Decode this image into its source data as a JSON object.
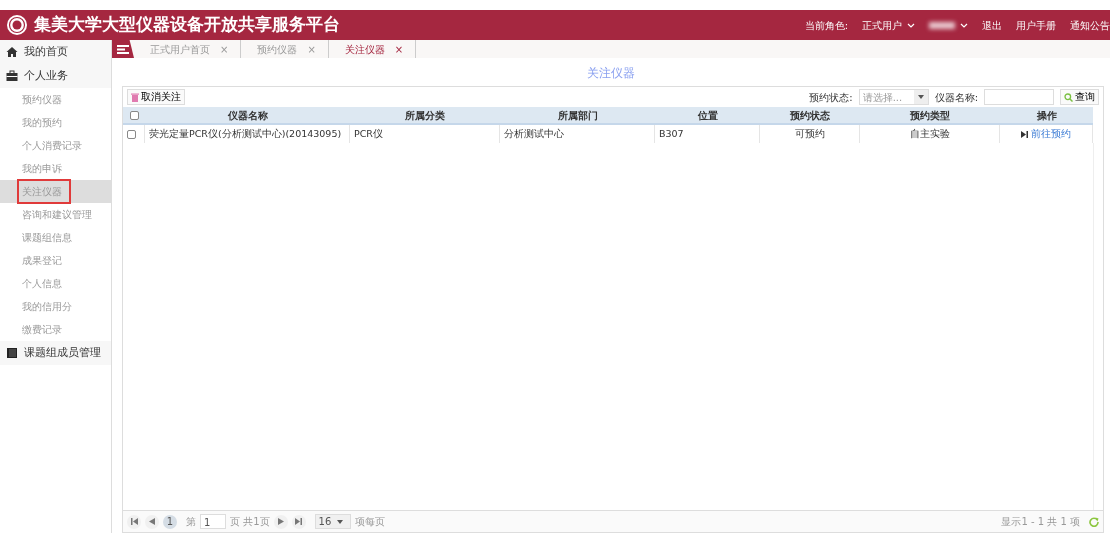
{
  "header": {
    "title": "集美大学大型仪器设备开放共享服务平台",
    "role_label": "当前角色:",
    "role": "正式用户",
    "links": [
      "退出",
      "用户手册",
      "通知公告"
    ]
  },
  "sidebar": [
    {
      "label": "我的首页",
      "kind": "home"
    },
    {
      "label": "个人业务",
      "kind": "case",
      "children": [
        {
          "label": "预约仪器",
          "selected": false
        },
        {
          "label": "我的预约",
          "selected": false
        },
        {
          "label": "个人消费记录",
          "selected": false
        },
        {
          "label": "我的申诉",
          "selected": false
        },
        {
          "label": "关注仪器",
          "selected": true
        },
        {
          "label": "咨询和建议管理",
          "selected": false
        },
        {
          "label": "课题组信息",
          "selected": false
        },
        {
          "label": "成果登记",
          "selected": false
        },
        {
          "label": "个人信息",
          "selected": false
        },
        {
          "label": "我的信用分",
          "selected": false
        },
        {
          "label": "缴费记录",
          "selected": false
        }
      ]
    },
    {
      "label": "课题组成员管理",
      "kind": "book"
    }
  ],
  "tabs": [
    {
      "label": "正式用户首页",
      "close": "×",
      "selected": false
    },
    {
      "label": "预约仪器",
      "close": "×",
      "selected": false
    },
    {
      "label": "关注仪器",
      "close": "×",
      "selected": true
    }
  ],
  "page_title": "关注仪器",
  "toolbar": {
    "unfollow": "取消关注",
    "status_label": "预约状态:",
    "status_placeholder": "请选择...",
    "name_label": "仪器名称:",
    "search": "查询"
  },
  "table": {
    "select_all_checked": false,
    "columns": [
      "仪器名称",
      "所属分类",
      "所属部门",
      "位置",
      "预约状态",
      "预约类型",
      "操作"
    ],
    "rows": [
      {
        "checked": false,
        "cells": [
          "荧光定量PCR仪(分析测试中心)(20143095)",
          "PCR仪",
          "分析测试中心",
          "B307",
          "可预约",
          "自主实验"
        ],
        "action": "前往预约"
      }
    ]
  },
  "pager": {
    "current": "1",
    "page_prefix": "第",
    "page_value": "1",
    "page_suffix": "页 共1页",
    "page_size": "16",
    "per_page": "项每页",
    "summary": "显示1 - 1 共 1 项"
  }
}
